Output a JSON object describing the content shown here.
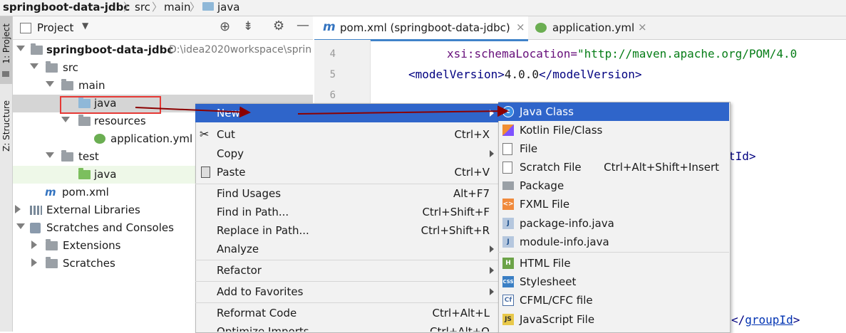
{
  "breadcrumb": {
    "project": "springboot-data-jdbc",
    "part1": "src",
    "part2": "main",
    "part3": "java"
  },
  "left_strip": {
    "project_tab": "1: Project",
    "structure_tab": "Z: Structure"
  },
  "project_panel": {
    "title": "Project"
  },
  "tree": {
    "root": "springboot-data-jdbc",
    "root_path": "D:\\idea2020workspace\\sprin",
    "src": "src",
    "main": "main",
    "java": "java",
    "resources": "resources",
    "application_yml": "application.yml",
    "test": "test",
    "test_java": "java",
    "pom": "pom.xml",
    "ext_libs": "External Libraries",
    "scratches_consoles": "Scratches and Consoles",
    "extensions": "Extensions",
    "scratches": "Scratches"
  },
  "tabs": [
    {
      "label": "pom.xml (springboot-data-jdbc)"
    },
    {
      "label": "application.yml"
    }
  ],
  "editor": {
    "line_numbers": [
      "4",
      "5",
      "6"
    ],
    "line4_attr": "xsi:schemaLocation=",
    "line4_val": "\"http://maven.apache.org/POM/4.0",
    "line5_open": "<modelVersion>",
    "line5_val": "4.0.0",
    "line5_close": "</modelVersion>",
    "frag_tid": "tId>",
    "frag_gid_open": "</",
    "frag_gid": "groupId",
    "frag_gid_close": ">"
  },
  "context_menu": {
    "new": "New",
    "cut": "Cut",
    "cut_sc": "Ctrl+X",
    "copy": "Copy",
    "paste": "Paste",
    "paste_sc": "Ctrl+V",
    "find_usages": "Find Usages",
    "find_usages_sc": "Alt+F7",
    "find_in_path": "Find in Path...",
    "find_in_path_sc": "Ctrl+Shift+F",
    "replace_in_path": "Replace in Path...",
    "replace_in_path_sc": "Ctrl+Shift+R",
    "analyze": "Analyze",
    "refactor": "Refactor",
    "add_favorites": "Add to Favorites",
    "reformat": "Reformat Code",
    "reformat_sc": "Ctrl+Alt+L",
    "optimize": "Optimize Imports",
    "optimize_sc": "Ctrl+Alt+O"
  },
  "new_submenu": {
    "java_class": "Java Class",
    "kotlin": "Kotlin File/Class",
    "file": "File",
    "scratch": "Scratch File",
    "scratch_sc": "Ctrl+Alt+Shift+Insert",
    "package": "Package",
    "fxml": "FXML File",
    "package_info": "package-info.java",
    "module_info": "module-info.java",
    "html": "HTML File",
    "stylesheet": "Stylesheet",
    "cfml": "CFML/CFC file",
    "javascript": "JavaScript File"
  },
  "colors": {
    "selection": "#2f65ca",
    "folder": "#8fb8d8",
    "gray_folder": "#9aa0a6",
    "arrow": "#8b0000"
  }
}
